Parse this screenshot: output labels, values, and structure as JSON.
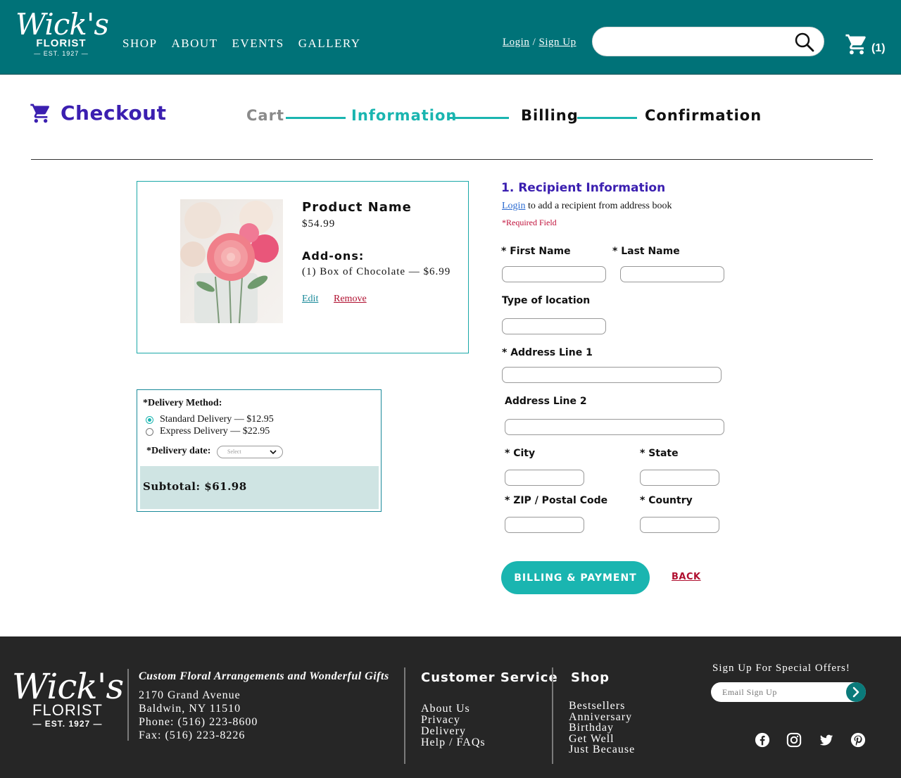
{
  "header": {
    "logo_script": "Wick's",
    "logo_florist": "FLORIST",
    "logo_est": "— EST. 1927 —",
    "nav": [
      "SHOP",
      "ABOUT",
      "EVENTS",
      "GALLERY"
    ],
    "login": "Login",
    "auth_sep": "/",
    "signup": "Sign Up",
    "search_placeholder": "",
    "cart_count": "(1)"
  },
  "checkout": {
    "title": "Checkout",
    "steps": [
      "Cart",
      "Information",
      "Billing",
      "Confirmation"
    ],
    "colors": {
      "accent": "#1ab5b0",
      "title": "#3b1fb0",
      "header": "#007278"
    }
  },
  "product": {
    "name": "Product Name",
    "price": "$54.99",
    "addons_title": "Add-ons:",
    "addons_item": "(1) Box of Chocolate — $6.99",
    "edit": "Edit",
    "remove": "Remove"
  },
  "delivery": {
    "title": "*Delivery Method:",
    "options": [
      "Standard Delivery — $12.95",
      "Express Delivery — $22.95"
    ],
    "selected": "Standard Delivery — $12.95",
    "date_label": "*Delivery date:",
    "date_select": "Select",
    "subtotal": "Subtotal: $61.98"
  },
  "form": {
    "title": "1. Recipient Information",
    "login_link": "Login",
    "login_note": " to add a recipient from address book",
    "required_note": "*Required Field",
    "labels": {
      "first_name": "* First Name",
      "last_name": "* Last Name",
      "location_type": "Type of location",
      "address1": "* Address Line 1",
      "address2": "Address Line 2",
      "city": "* City",
      "state": "* State",
      "zip": "* ZIP / Postal Code",
      "country": "* Country"
    },
    "billing_button": "BILLING & PAYMENT",
    "back": "BACK"
  },
  "footer": {
    "logo_script": "Wick's",
    "logo_florist": "FLORIST",
    "logo_est": "— EST. 1927 —",
    "tagline": "Custom Floral Arrangements and Wonderful Gifts",
    "address": [
      "2170 Grand Avenue",
      "Baldwin, NY 11510",
      "Phone: (516) 223-8600",
      "Fax: (516) 223-8226"
    ],
    "customer_service_title": "Customer Service",
    "customer_service": [
      "About Us",
      "Privacy",
      "Delivery",
      "Help / FAQs"
    ],
    "shop_title": "Shop",
    "shop": [
      "Bestsellers",
      "Anniversary",
      "Birthday",
      "Get Well",
      "Just Because"
    ],
    "signup_title": "Sign Up For Special Offers!",
    "email_placeholder": "Email Sign Up",
    "social_icons": [
      "facebook-icon",
      "instagram-icon",
      "twitter-icon",
      "pinterest-icon"
    ]
  }
}
